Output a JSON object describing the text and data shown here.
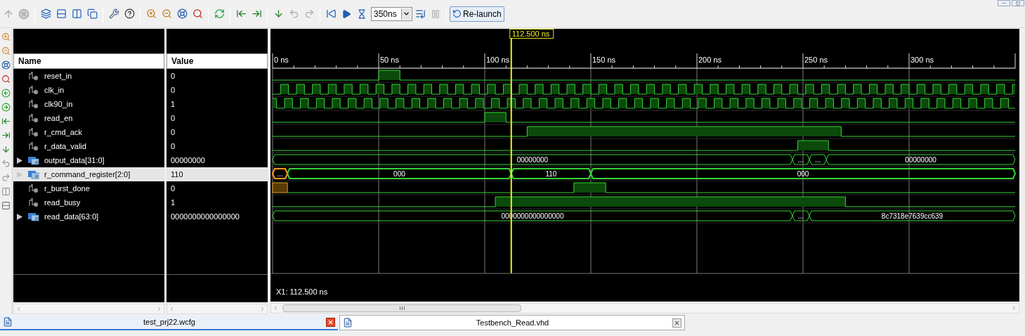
{
  "toolbar": {
    "time_field": {
      "value": "350ns"
    },
    "relaunch_button": {
      "label": "Re-launch"
    }
  },
  "name_panel": {
    "header": "Name"
  },
  "value_panel": {
    "header": "Value"
  },
  "signals": [
    {
      "name": "reset_in",
      "value": "0",
      "kind": "bit",
      "selected": false
    },
    {
      "name": "clk_in",
      "value": "0",
      "kind": "bit",
      "selected": false
    },
    {
      "name": "clk90_in",
      "value": "1",
      "kind": "bit",
      "selected": false
    },
    {
      "name": "read_en",
      "value": "0",
      "kind": "bit",
      "selected": false
    },
    {
      "name": "r_cmd_ack",
      "value": "0",
      "kind": "bit",
      "selected": false
    },
    {
      "name": "r_data_valid",
      "value": "0",
      "kind": "bit",
      "selected": false
    },
    {
      "name": "output_data[31:0]",
      "value": "00000000",
      "kind": "bus",
      "selected": false,
      "expanded": false,
      "segments": [
        {
          "label": "00000000",
          "kind": "value"
        },
        {
          "label": "...",
          "kind": "value"
        },
        {
          "label": "...",
          "kind": "value"
        },
        {
          "label": "00000000",
          "kind": "value"
        }
      ]
    },
    {
      "name": "r_command_register[2:0]",
      "value": "110",
      "kind": "bus",
      "selected": true,
      "expanded": false,
      "segments": [
        {
          "label": "...",
          "kind": "unknown"
        },
        {
          "label": "000",
          "kind": "value"
        },
        {
          "label": "110",
          "kind": "value"
        },
        {
          "label": "000",
          "kind": "value"
        }
      ]
    },
    {
      "name": "r_burst_done",
      "value": "0",
      "kind": "bit",
      "selected": false
    },
    {
      "name": "read_busy",
      "value": "1",
      "kind": "bit",
      "selected": false
    },
    {
      "name": "read_data[63:0]",
      "value": "0000000000000000",
      "kind": "bus",
      "selected": false,
      "expanded": false,
      "segments": [
        {
          "label": "0000000000000000",
          "kind": "value"
        },
        {
          "label": "...",
          "kind": "value"
        },
        {
          "label": "8c7318e7639cc639",
          "kind": "value"
        }
      ]
    }
  ],
  "timeline": {
    "ticks": [
      "0 ns",
      "50 ns",
      "100 ns",
      "150 ns",
      "200 ns",
      "250 ns",
      "300 ns"
    ],
    "cursor": "112.500 ns",
    "cursor_readout": "X1: 112.500 ns"
  },
  "tabs": [
    {
      "label": "test_prj22.wcfg",
      "selected": true
    },
    {
      "label": "Testbench_Read.vhd",
      "selected": false
    }
  ]
}
